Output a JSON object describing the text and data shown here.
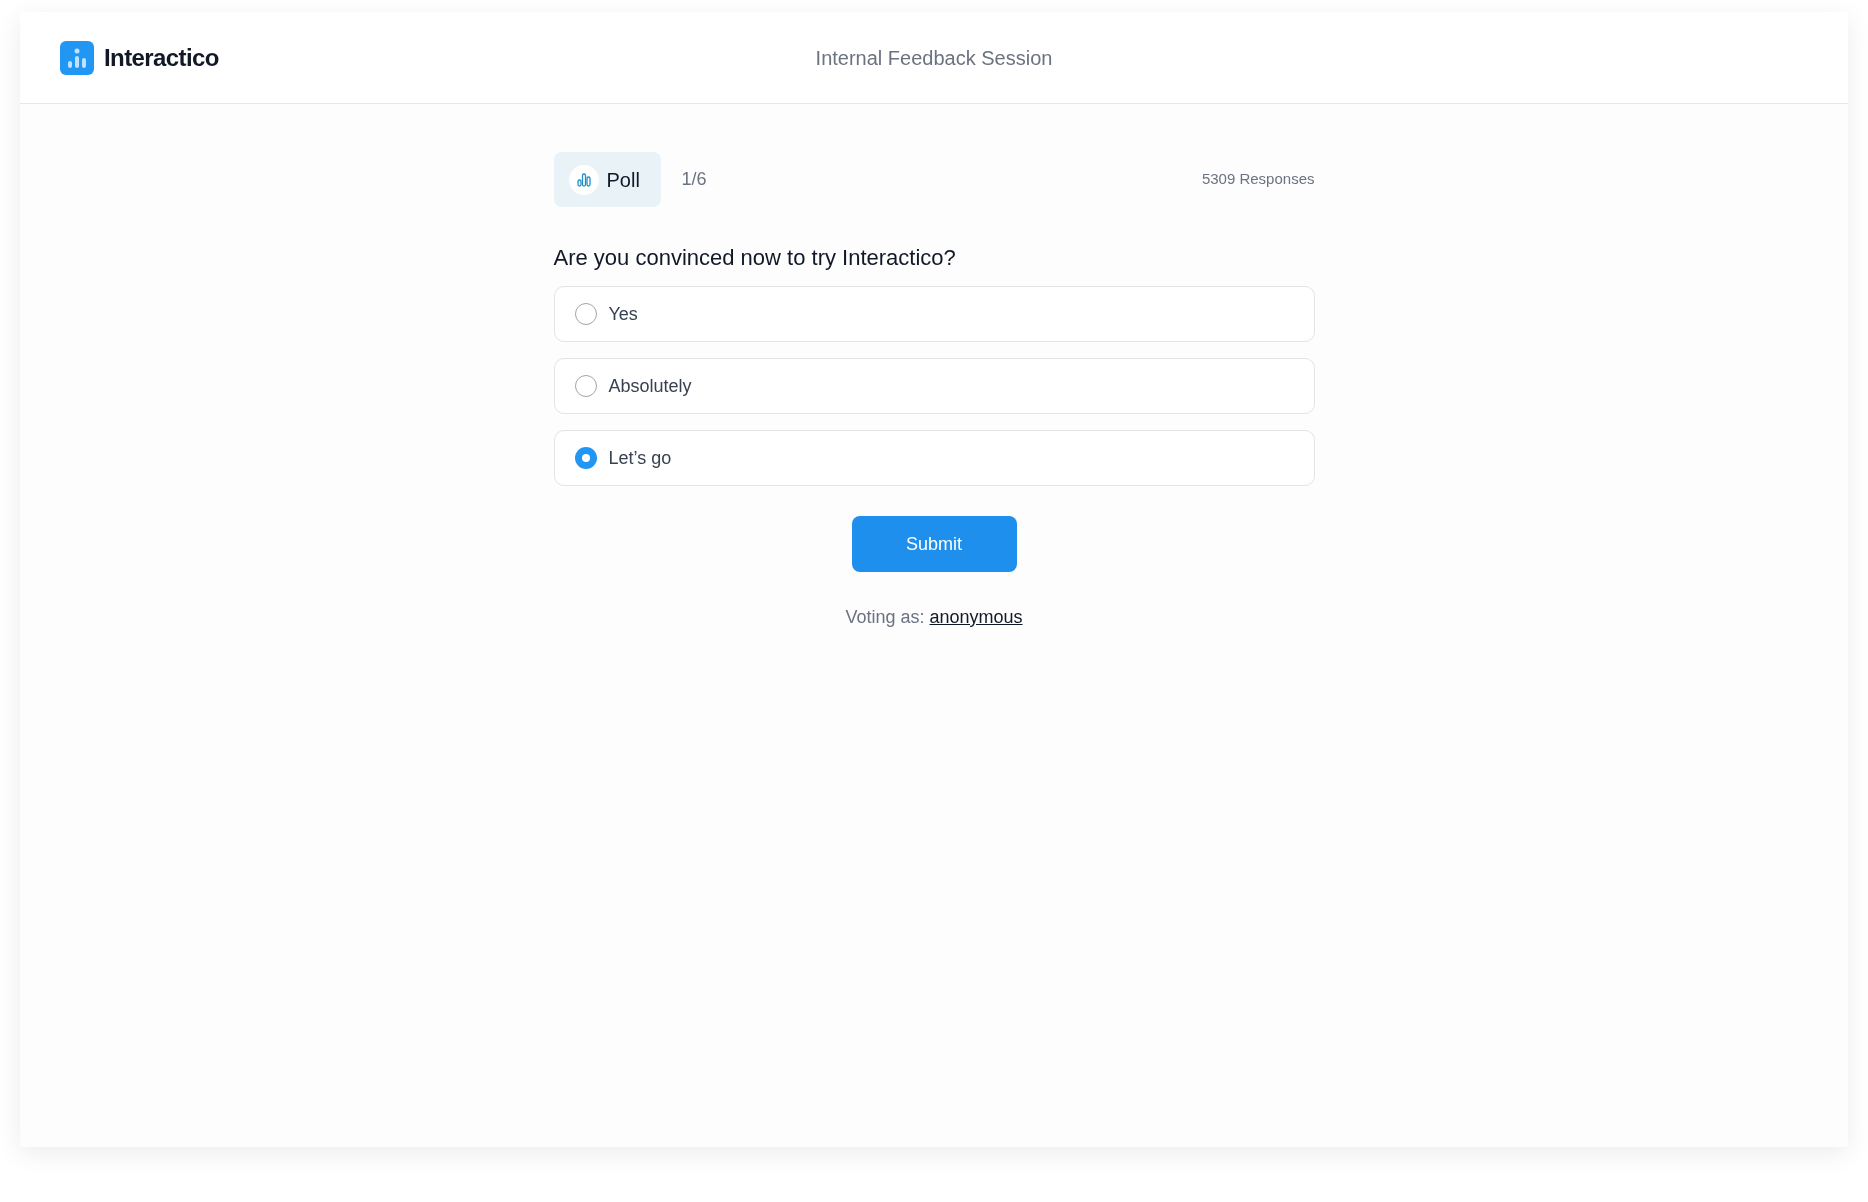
{
  "header": {
    "brand": "Interactico",
    "session_title": "Internal Feedback Session"
  },
  "poll": {
    "type_label": "Poll",
    "progress": "1/6",
    "responses": "5309 Responses",
    "question": "Are you convinced now to try Interactico?",
    "options": [
      {
        "label": "Yes",
        "selected": false
      },
      {
        "label": "Absolutely",
        "selected": false
      },
      {
        "label": "Let’s go",
        "selected": true
      }
    ],
    "submit": "Submit",
    "voting_label": "Voting as:",
    "voter": "anonymous"
  }
}
